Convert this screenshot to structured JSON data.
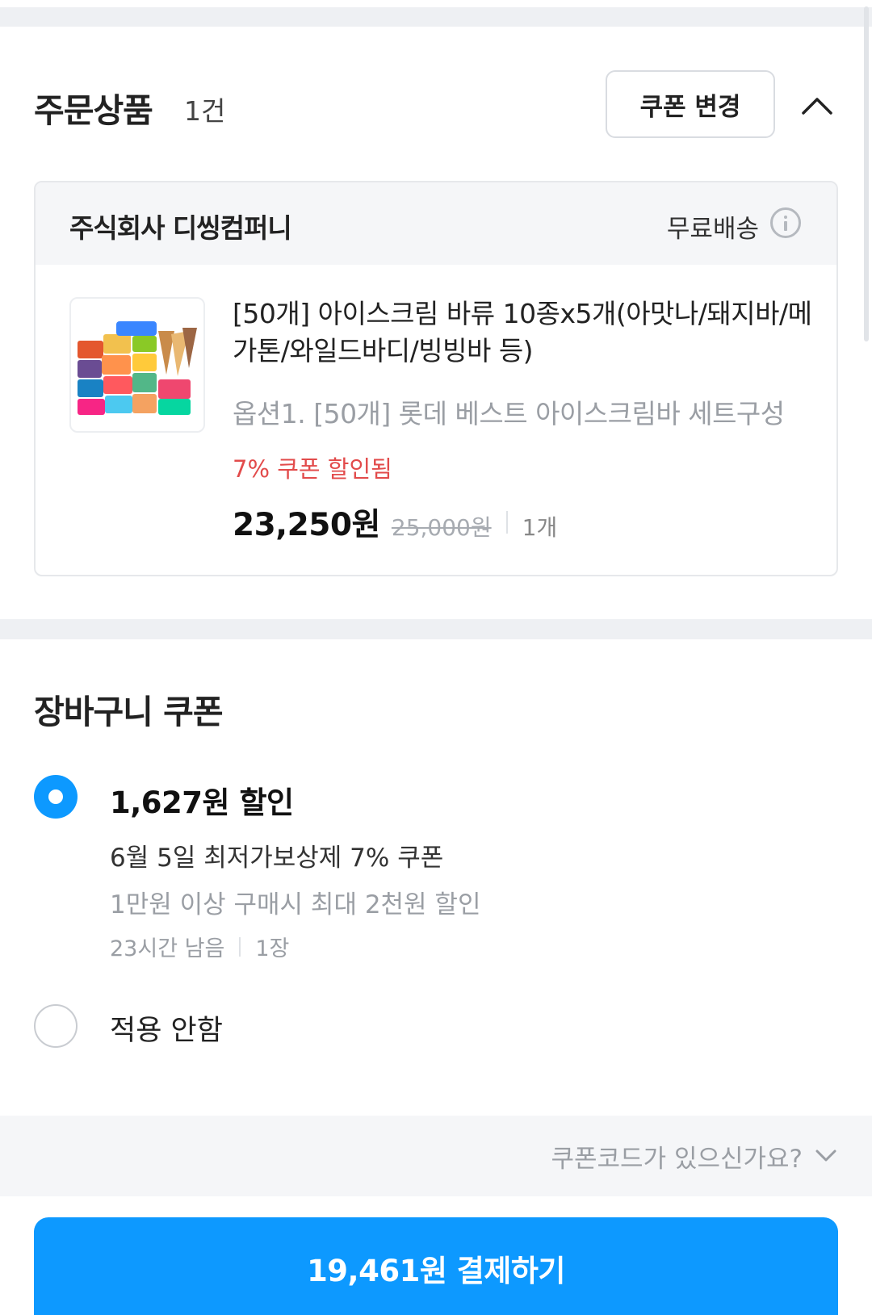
{
  "order": {
    "title": "주문상품",
    "count": "1건",
    "coupon_change_label": "쿠폰 변경"
  },
  "seller": {
    "name": "주식회사 디씽컴퍼니",
    "shipping": "무료배송"
  },
  "product": {
    "title": "[50개] 아이스크림 바류 10종x5개(아맛나/돼지바/메가톤/와일드바디/빙빙바 등)",
    "option": "옵션1. [50개] 롯데 베스트 아이스크림바 세트구성",
    "coupon_applied": "7% 쿠폰 할인됨",
    "price": "23,250원",
    "original_price": "25,000원",
    "quantity": "1개"
  },
  "cart_coupon": {
    "title": "장바구니 쿠폰",
    "selected": {
      "amount": "1,627원 할인",
      "name": "6월 5일 최저가보상제 7% 쿠폰",
      "condition": "1만원 이상 구매시 최대 2천원 할인",
      "remaining": "23시간 남음",
      "count": "1장"
    },
    "none_label": "적용 안함",
    "code_prompt": "쿠폰코드가 있으신가요?"
  },
  "payment": {
    "button_label": "19,461원 결제하기"
  },
  "colors": {
    "accent": "#0d99ff",
    "discount_red": "#e24b4b",
    "section_gray": "#eef0f3"
  }
}
